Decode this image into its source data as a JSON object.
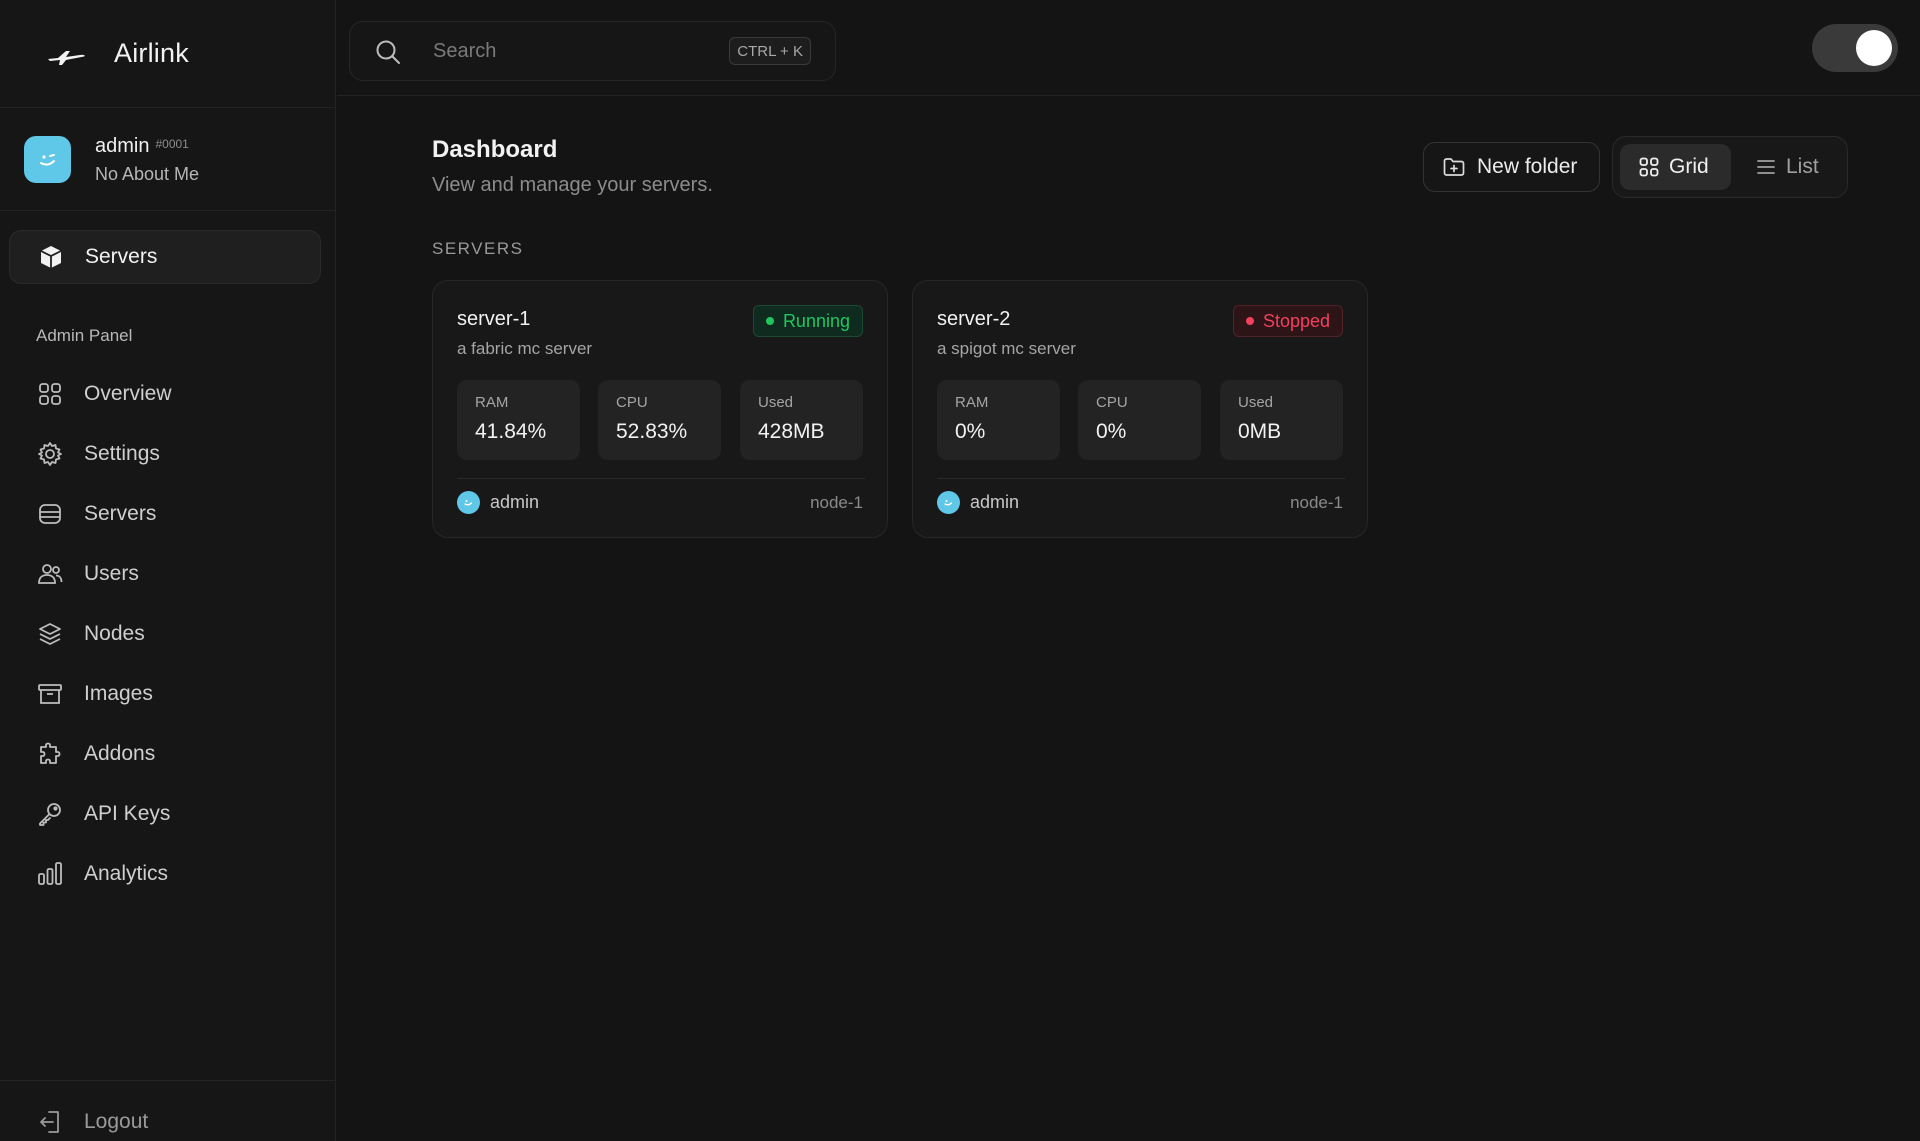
{
  "brand": {
    "name": "Airlink"
  },
  "profile": {
    "name": "admin",
    "tag": "#0001",
    "about": "No About Me"
  },
  "nav": {
    "primary": {
      "label": "Servers",
      "icon": "cube-icon"
    },
    "section_label": "Admin Panel",
    "items": [
      {
        "label": "Overview",
        "icon": "grid-icon"
      },
      {
        "label": "Settings",
        "icon": "gear-icon"
      },
      {
        "label": "Servers",
        "icon": "server-stack-icon"
      },
      {
        "label": "Users",
        "icon": "users-icon"
      },
      {
        "label": "Nodes",
        "icon": "layers-icon"
      },
      {
        "label": "Images",
        "icon": "archive-icon"
      },
      {
        "label": "Addons",
        "icon": "puzzle-icon"
      },
      {
        "label": "API Keys",
        "icon": "key-icon"
      },
      {
        "label": "Analytics",
        "icon": "bar-chart-icon"
      }
    ],
    "logout": {
      "label": "Logout",
      "icon": "logout-icon"
    }
  },
  "search": {
    "placeholder": "Search",
    "value": "",
    "shortcut": "CTRL + K"
  },
  "theme_toggle": {
    "state": "on"
  },
  "page": {
    "title": "Dashboard",
    "subtitle": "View and manage your servers.",
    "new_folder_label": "New folder",
    "view": {
      "grid_label": "Grid",
      "list_label": "List",
      "active": "grid"
    },
    "servers_label": "SERVERS"
  },
  "servers": [
    {
      "name": "server-1",
      "description": "a fabric mc server",
      "status": "Running",
      "stats": [
        {
          "label": "RAM",
          "value": "41.84%"
        },
        {
          "label": "CPU",
          "value": "52.83%"
        },
        {
          "label": "Used",
          "value": "428MB"
        }
      ],
      "owner": "admin",
      "node": "node-1"
    },
    {
      "name": "server-2",
      "description": "a spigot mc server",
      "status": "Stopped",
      "stats": [
        {
          "label": "RAM",
          "value": "0%"
        },
        {
          "label": "CPU",
          "value": "0%"
        },
        {
          "label": "Used",
          "value": "0MB"
        }
      ],
      "owner": "admin",
      "node": "node-1"
    }
  ],
  "colors": {
    "background": "#141414",
    "running": "#22c55e",
    "stopped": "#f43f5e",
    "avatar": "#5fc7e8"
  }
}
